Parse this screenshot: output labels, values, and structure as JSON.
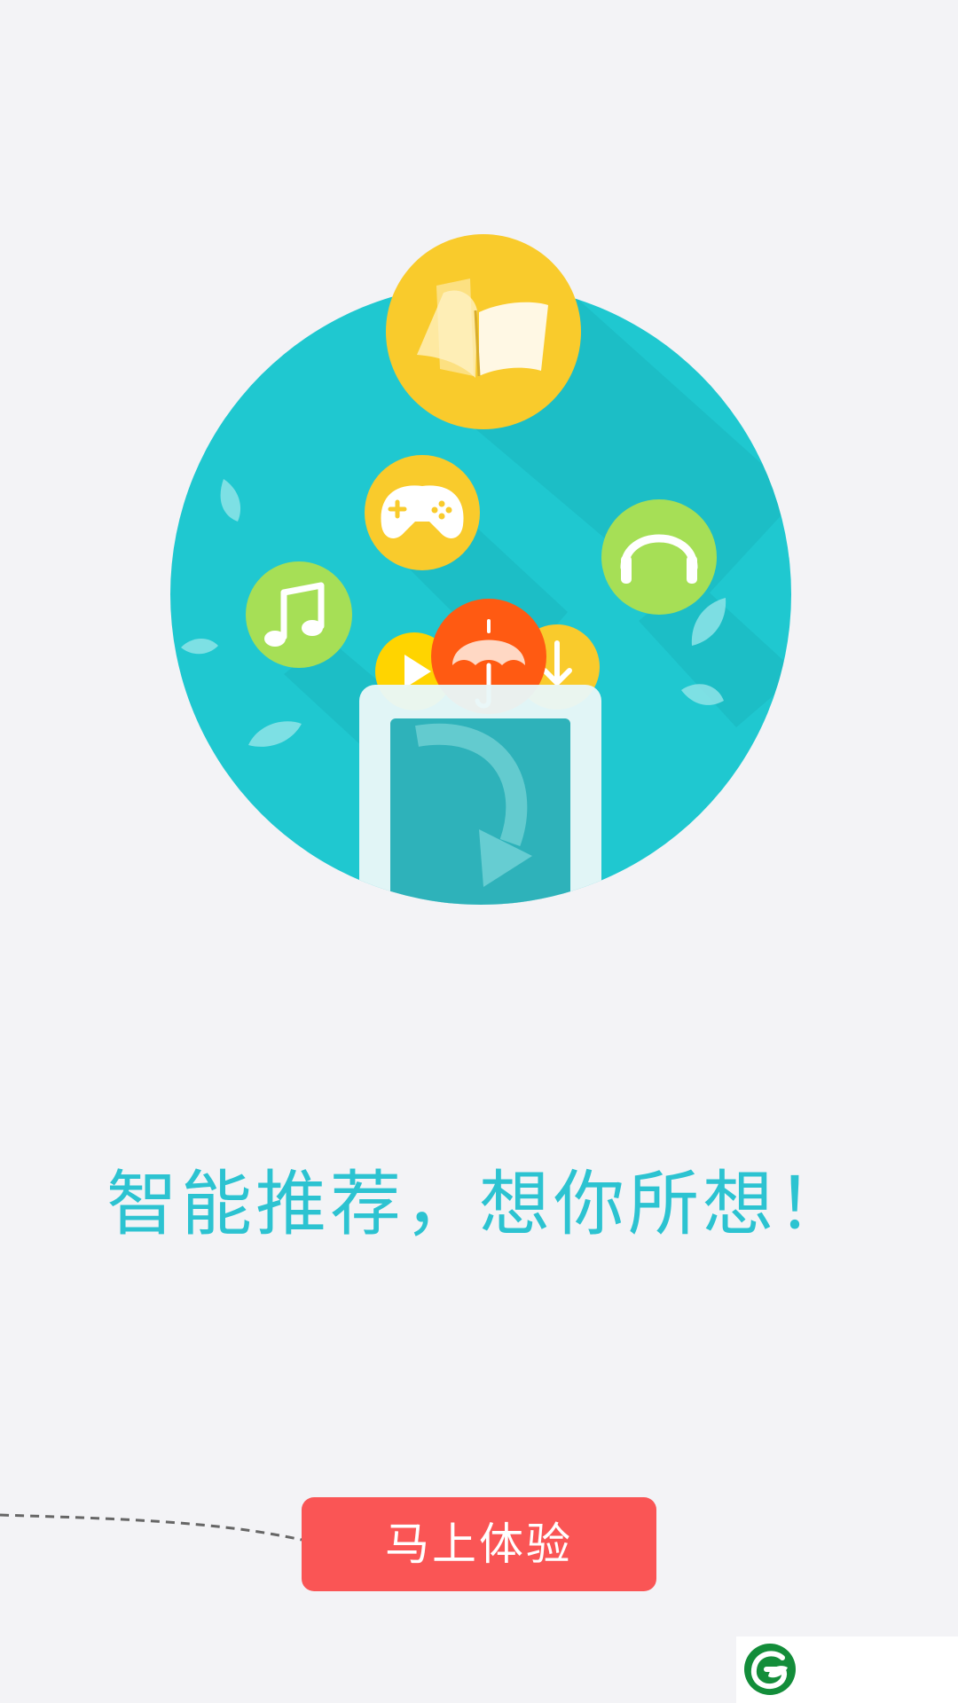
{
  "tagline": "智能推荐，想你所想！",
  "cta": {
    "label": "马上体验"
  },
  "icons": {
    "book": "book-icon",
    "gamepad": "gamepad-icon",
    "music": "music-note-icon",
    "headphones": "headphones-icon",
    "play": "play-icon",
    "umbrella": "umbrella-icon",
    "download": "download-icon",
    "phone": "phone-icon",
    "brand": "leaf-logo-icon"
  },
  "colors": {
    "background": "#f3f3f6",
    "circle": "#1fc8d0",
    "accent_text": "#2cc3d1",
    "button": "#fa5555",
    "yellow": "#f9cb2c",
    "green": "#a6df56",
    "orange": "#ff5a12",
    "brand_green": "#138d3a"
  }
}
